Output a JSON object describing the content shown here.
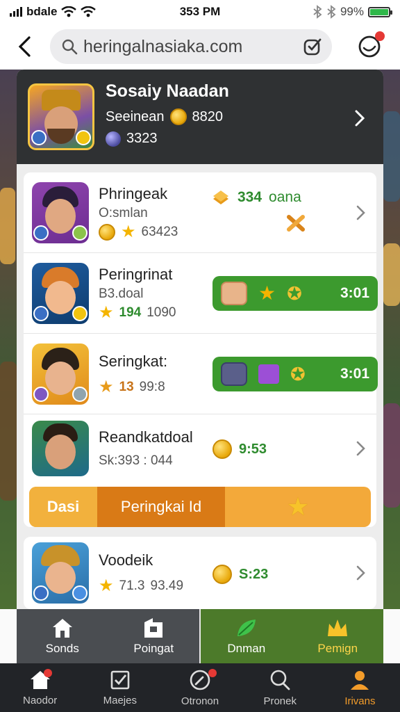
{
  "status_bar": {
    "carrier": "bdale",
    "time": "353 PM",
    "battery": "99%",
    "battery_level": 0.99
  },
  "browser": {
    "url": "heringalnasiaka.com"
  },
  "profile": {
    "name": "Sosaiy Naadan",
    "subtitle": "Seeinean",
    "coins": "8820",
    "gems": "3323"
  },
  "items": [
    {
      "name": "Phringeak",
      "sub": "O:smlan",
      "stat": "63423",
      "reward_value": "334",
      "reward_label": "oana"
    },
    {
      "name": "Peringrinat",
      "sub": "B3.doal",
      "stat_a": "194",
      "stat_b": "1090",
      "pill_time": "3:01"
    },
    {
      "name": "Seringkat:",
      "stat_a": "13",
      "stat_b": "99:8",
      "pill_time": "3:01"
    },
    {
      "name": "Reandkatdoal",
      "sub": "Sk:393 : 044",
      "reward": "9:53"
    },
    {
      "name": "Voodeik",
      "stat_a": "71.3",
      "stat_b": "93.49",
      "reward": "S:23"
    }
  ],
  "orange_bar": {
    "left": "Dasi",
    "middle": "Peringkai Id"
  },
  "game_nav": [
    {
      "label": "Sonds"
    },
    {
      "label": "Poingat"
    },
    {
      "label": "Dnman"
    },
    {
      "label": "Pemign"
    }
  ],
  "tab_bar": [
    {
      "label": "Naodor"
    },
    {
      "label": "Maejes"
    },
    {
      "label": "Otronon"
    },
    {
      "label": "Pronek"
    },
    {
      "label": "Irivans"
    }
  ],
  "colors": {
    "accent_green": "#3c9a2e",
    "accent_orange": "#d97a16",
    "tab_active": "#f39c2a",
    "header_dark": "#2f3133"
  }
}
